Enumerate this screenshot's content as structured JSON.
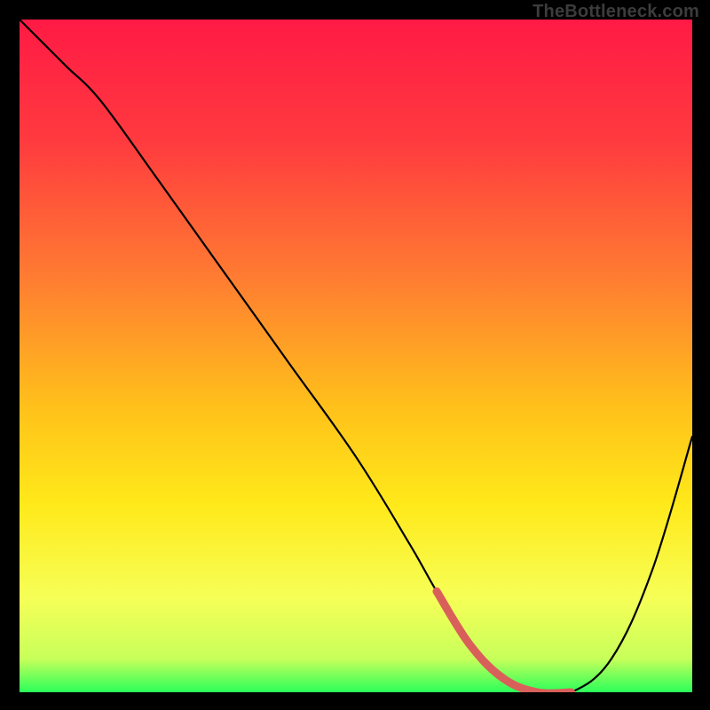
{
  "watermark": "TheBottleneck.com",
  "chart_data": {
    "type": "line",
    "title": "",
    "xlabel": "",
    "ylabel": "",
    "xlim": [
      0,
      100
    ],
    "ylim": [
      0,
      100
    ],
    "gradient_stops": [
      {
        "offset": 0,
        "color": "#ff1a45"
      },
      {
        "offset": 18,
        "color": "#ff3a3f"
      },
      {
        "offset": 38,
        "color": "#ff7b32"
      },
      {
        "offset": 58,
        "color": "#ffc21a"
      },
      {
        "offset": 72,
        "color": "#ffe91a"
      },
      {
        "offset": 86,
        "color": "#f6ff57"
      },
      {
        "offset": 95,
        "color": "#c8ff5a"
      },
      {
        "offset": 100,
        "color": "#2bff5a"
      }
    ],
    "series": [
      {
        "name": "bottleneck-curve",
        "x": [
          0,
          4,
          7,
          12,
          20,
          30,
          40,
          50,
          58,
          62,
          67,
          72,
          77,
          82,
          88,
          94,
          100
        ],
        "y": [
          100,
          96,
          93,
          88,
          77,
          63,
          49,
          35,
          22,
          15,
          7,
          2,
          0,
          0,
          5,
          18,
          38
        ]
      }
    ],
    "highlight": {
      "name": "optimal-range",
      "x": [
        62,
        67,
        72,
        77,
        82
      ],
      "y": [
        15,
        7,
        2,
        0,
        0
      ],
      "color": "#d9605a",
      "width": 9
    }
  }
}
